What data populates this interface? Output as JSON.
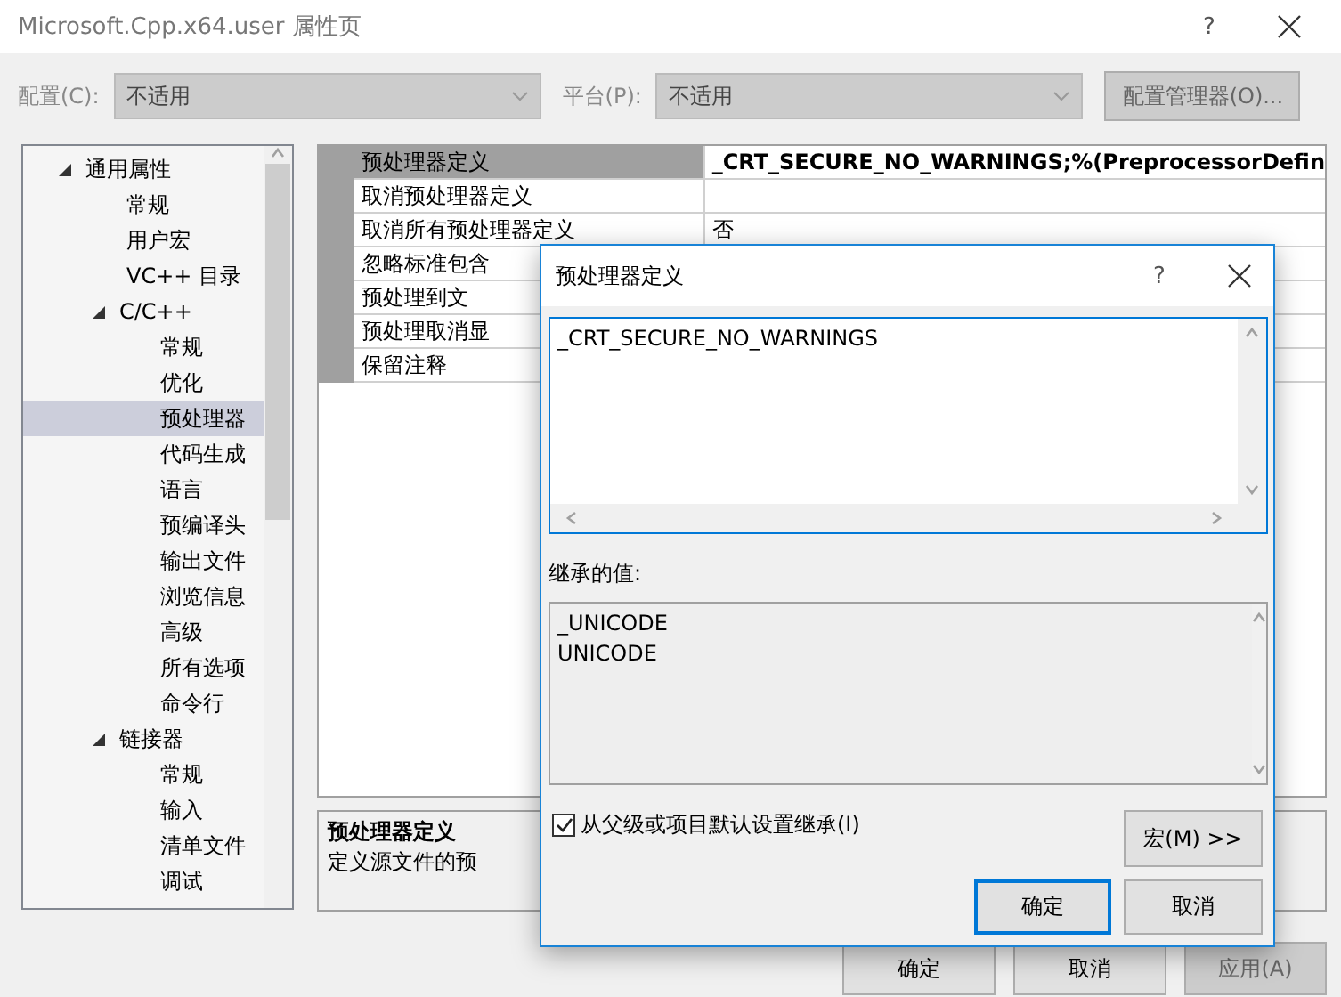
{
  "window": {
    "title": "Microsoft.Cpp.x64.user 属性页",
    "help": "?"
  },
  "toolbar": {
    "config_label": "配置(C):",
    "config_value": "不适用",
    "platform_label": "平台(P):",
    "platform_value": "不适用",
    "manager_button": "配置管理器(O)...",
    "disabled": true
  },
  "tree": [
    {
      "label": "通用属性",
      "expanded": true,
      "selected": false,
      "children": [
        {
          "label": "常规",
          "selected": false
        },
        {
          "label": "用户宏",
          "selected": false
        },
        {
          "label": "VC++ 目录",
          "selected": false
        },
        {
          "label": "C/C++",
          "expanded": true,
          "selected": false,
          "children": [
            {
              "label": "常规",
              "selected": false
            },
            {
              "label": "优化",
              "selected": false
            },
            {
              "label": "预处理器",
              "selected": true
            },
            {
              "label": "代码生成",
              "selected": false
            },
            {
              "label": "语言",
              "selected": false
            },
            {
              "label": "预编译头",
              "selected": false
            },
            {
              "label": "输出文件",
              "selected": false
            },
            {
              "label": "浏览信息",
              "selected": false
            },
            {
              "label": "高级",
              "selected": false
            },
            {
              "label": "所有选项",
              "selected": false
            },
            {
              "label": "命令行",
              "selected": false
            }
          ]
        },
        {
          "label": "链接器",
          "expanded": true,
          "selected": false,
          "children": [
            {
              "label": "常规",
              "selected": false
            },
            {
              "label": "输入",
              "selected": false
            },
            {
              "label": "清单文件",
              "selected": false
            },
            {
              "label": "调试",
              "selected": false
            }
          ]
        }
      ]
    }
  ],
  "grid": {
    "rows": [
      {
        "name": "预处理器定义",
        "value": "_CRT_SECURE_NO_WARNINGS;%(PreprocessorDefin",
        "selected": true
      },
      {
        "name": "取消预处理器定义",
        "selected": false
      },
      {
        "name": "取消所有预处理器定义",
        "value": "否",
        "selected": false
      },
      {
        "name": "忽略标准包含",
        "selected": false
      },
      {
        "name": "预处理到文",
        "selected": false
      },
      {
        "name": "预处理取消显",
        "selected": false
      },
      {
        "name": "保留注释",
        "selected": false
      }
    ]
  },
  "description": {
    "title": "预处理器定义",
    "text": "定义源文件的预"
  },
  "buttons": [
    {
      "label": "确定"
    },
    {
      "label": "取消"
    },
    {
      "label": "应用(A)"
    }
  ],
  "dialog": {
    "title": "预处理器定义",
    "help": "?",
    "value": "_CRT_SECURE_NO_WARNINGS",
    "inherited_label": "继承的值:",
    "inherited": [
      "_UNICODE",
      "UNICODE"
    ],
    "inherit_checkbox": {
      "label": "从父级或项目默认设置继承(I)",
      "checked": true
    },
    "macro_button": "宏(M) >>",
    "ok_button": "确定",
    "cancel_button": "取消"
  }
}
